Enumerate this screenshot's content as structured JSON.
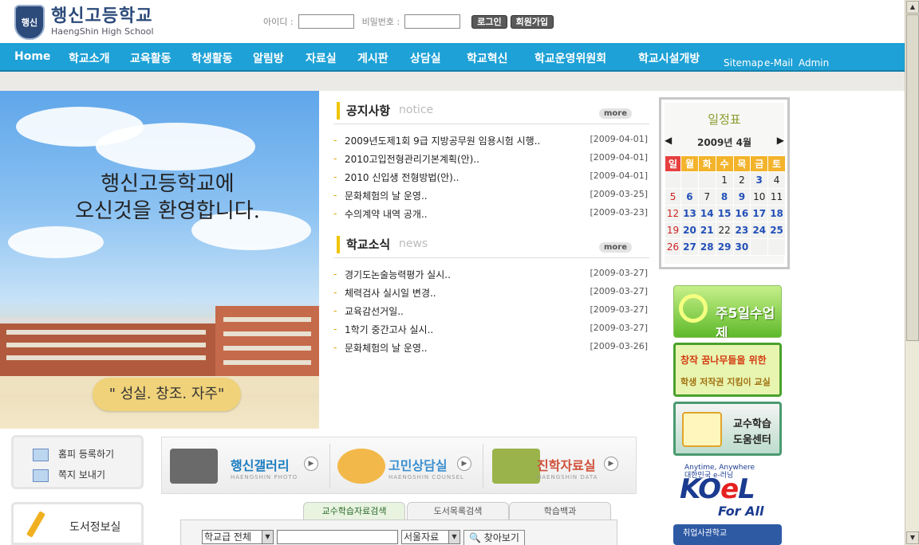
{
  "header": {
    "school_name": "행신고등학교",
    "school_name_en": "HaengShin High School",
    "emblem_text": "행신",
    "login": {
      "id_label": "아이디 :",
      "pw_label": "비밀번호 :",
      "login_button": "로그인",
      "join_button": "회원가입"
    }
  },
  "nav": {
    "items": [
      "Home",
      "학교소개",
      "교육활동",
      "학생활동",
      "알림방",
      "자료실",
      "게시판",
      "상담실",
      "학교혁신",
      "학교운영위원회",
      "학교시설개방"
    ],
    "utils": [
      "Sitemap",
      "e-Mail",
      "Admin"
    ]
  },
  "hero": {
    "welcome_line1": "행신고등학교에",
    "welcome_line2": "오신것을 환영합니다.",
    "motto": "\" 성실. 창조. 자주\""
  },
  "notice": {
    "title": "공지사항",
    "sub": "notice",
    "more": "more",
    "rows": [
      {
        "title": "2009년도제1회 9급 지방공무원 임용시험 시행..",
        "date": "[2009-04-01]"
      },
      {
        "title": "2010고입전형관리기본계획(안)..",
        "date": "[2009-04-01]"
      },
      {
        "title": "2010 신입생 전형방법(안)..",
        "date": "[2009-04-01]"
      },
      {
        "title": "문화체험의 날 운영..",
        "date": "[2009-03-25]"
      },
      {
        "title": "수의계약 내역 공개..",
        "date": "[2009-03-23]"
      }
    ]
  },
  "news": {
    "title": "학교소식",
    "sub": "news",
    "more": "more",
    "rows": [
      {
        "title": "경기도논술능력평가 실시..",
        "date": "[2009-03-27]"
      },
      {
        "title": "체력검사 실시일 변경..",
        "date": "[2009-03-27]"
      },
      {
        "title": "교육감선거일..",
        "date": "[2009-03-27]"
      },
      {
        "title": "1학기 중간고사 실시..",
        "date": "[2009-03-27]"
      },
      {
        "title": "문화체험의 날 운영..",
        "date": "[2009-03-26]"
      }
    ]
  },
  "calendar": {
    "title": "일정표",
    "month": "2009년 4월",
    "prev": "◀",
    "next": "▶",
    "weekdays": [
      "일",
      "월",
      "화",
      "수",
      "목",
      "금",
      "토"
    ],
    "weeks": [
      [
        "",
        "",
        "",
        "1",
        "2",
        "3",
        "4"
      ],
      [
        "5",
        "6",
        "7",
        "8",
        "9",
        "10",
        "11"
      ],
      [
        "12",
        "13",
        "14",
        "15",
        "16",
        "17",
        "18"
      ],
      [
        "19",
        "20",
        "21",
        "22",
        "23",
        "24",
        "25"
      ],
      [
        "26",
        "27",
        "28",
        "29",
        "30",
        "",
        ""
      ]
    ],
    "highlighted_days": [
      "3",
      "6",
      "8",
      "9",
      "13",
      "14",
      "15",
      "16",
      "17",
      "18",
      "20",
      "21",
      "23",
      "24",
      "25",
      "27",
      "28",
      "29",
      "30"
    ]
  },
  "banners": {
    "b1": "주5일수업제",
    "b2_line1": "창작 꿈나무들을 위한",
    "b2_line2": "학생 저작권 지킴이 교실",
    "b3_line1": "교수학습",
    "b3_line2": "도움센터",
    "b4_top": "Anytime, Anywhere",
    "b4_top2": "대한민국 e-러닝",
    "b4_k": "KO",
    "b4_e": "e",
    "b4_l": "L",
    "b4_bottom": "For All",
    "b5": "취업사관학교"
  },
  "quick": {
    "homepage": "홈피 등록하기",
    "note": "쪽지 보내기",
    "library": "도서정보실"
  },
  "gallery": [
    {
      "title": "행신갤러리",
      "sub": "HAENGSHIN PHOTO",
      "color": "#1a7cc0"
    },
    {
      "title": "고민상담실",
      "sub": "HAENGSHIN COUNSEL",
      "color": "#3a8fd0"
    },
    {
      "title": "진학자료실",
      "sub": "HAENGSHIN DATA",
      "color": "#d0503a"
    }
  ],
  "search": {
    "tabs": [
      "교수학습자료검색",
      "도서목록검색",
      "학습백과"
    ],
    "grade_select": "학교급 전체",
    "source_select": "서울자료",
    "go": "찾아보기"
  },
  "colors": {
    "nav": "#1ea1d6",
    "brand": "#2c4a7a",
    "accent": "#f0c400"
  }
}
